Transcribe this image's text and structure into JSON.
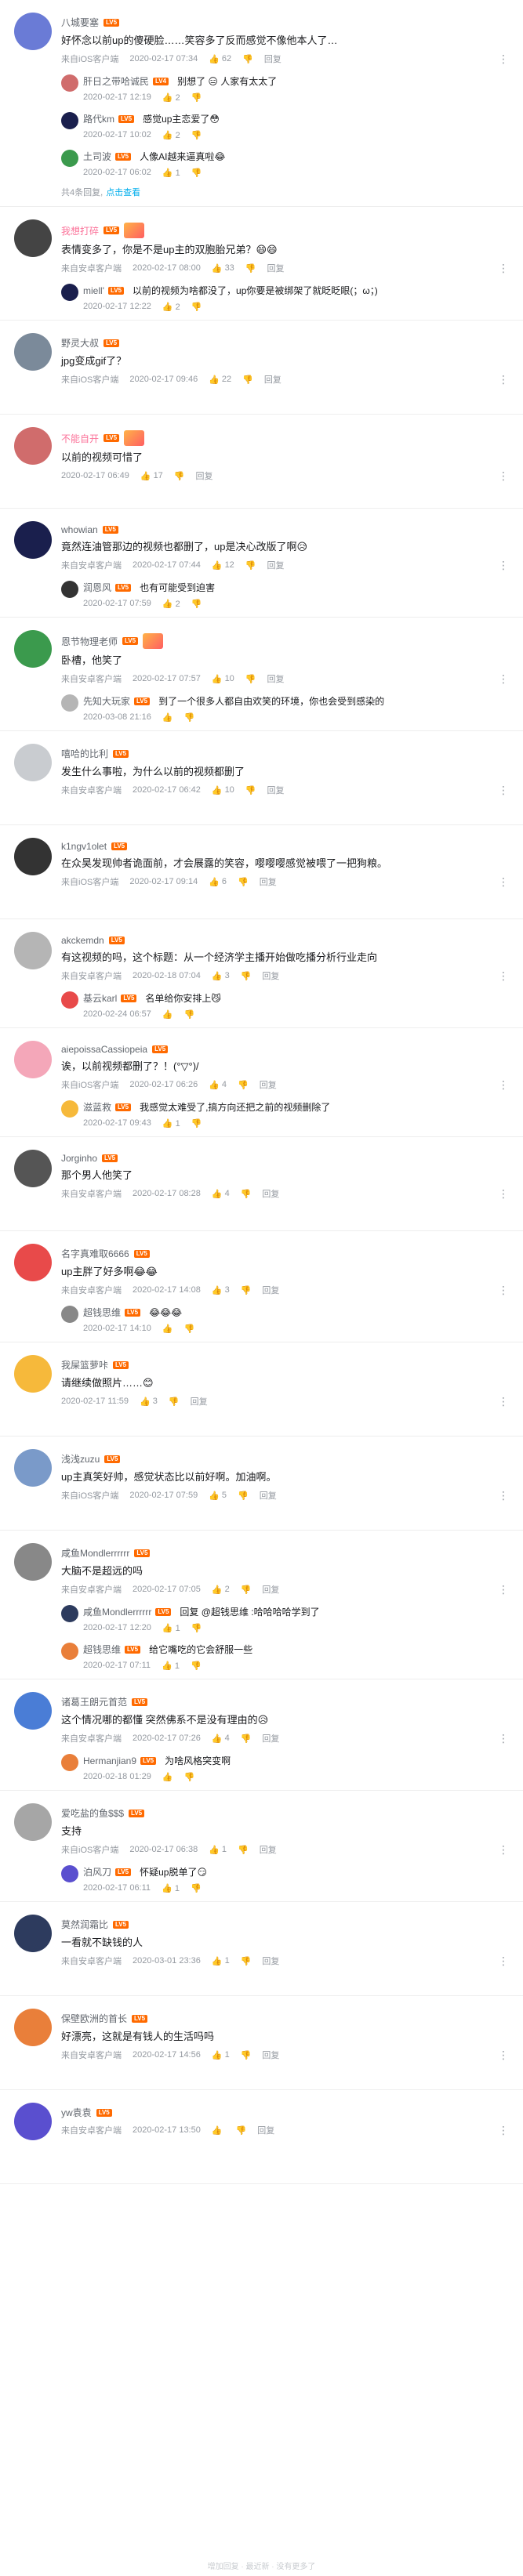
{
  "colors": {
    "accent": "#00aeec",
    "vip_name": "#fb7299",
    "meta": "#9499a0",
    "level_lv6": "#ff3b30",
    "level_lv5": "#ff6a00",
    "level_lv4": "#ff9f1a"
  },
  "comments": [
    {
      "name": "八城要塞",
      "level": "LV5",
      "text": "好怀念以前up的傻硬脸……笑容多了反而感觉不像他本人了…",
      "device": "来自iOS客户端",
      "time": "2020-02-17 07:34",
      "likes": "62",
      "reply": "回复",
      "replies": [
        {
          "name": "肝日之带哈诚民",
          "level": "LV4",
          "text": "别想了 😑 人家有太太了",
          "time": "2020-02-17 12:19",
          "likes": "2"
        },
        {
          "name": "路代km",
          "level": "LV5",
          "text": "感觉up主恋爱了😳",
          "time": "2020-02-17 10:02",
          "likes": "2"
        },
        {
          "name": "土司波",
          "level": "LV5",
          "text": "人像AI越来逼真啦😂",
          "time": "2020-02-17 06:02",
          "likes": "1"
        }
      ],
      "view_more_count": "共4条回复,",
      "view_more_link": "点击查看"
    },
    {
      "name": "我想打碎",
      "level": "LV5",
      "text": "表情变多了，你是不是up主的双胞胎兄弟？😄😄",
      "device": "来自安卓客户端",
      "time": "2020-02-17 08:00",
      "likes": "33",
      "reply": "回复",
      "replies": [
        {
          "name": "miell'",
          "level": "LV5",
          "text": "以前的视频为啥都没了，up你要是被绑架了就眨眨眼(；ω；)",
          "time": "2020-02-17 12:22",
          "likes": "2"
        }
      ]
    },
    {
      "name": "野灵大叔",
      "level": "LV5",
      "text": "jpg变成gif了？",
      "device": "来自iOS客户端",
      "time": "2020-02-17 09:46",
      "likes": "22",
      "reply": "回复",
      "replies": []
    },
    {
      "name": "不能自开",
      "level": "LV5",
      "text": "以前的视频可惜了",
      "device": "",
      "time": "2020-02-17 06:49",
      "likes": "17",
      "reply": "回复",
      "replies": []
    },
    {
      "name": "whowian",
      "level": "LV5",
      "text": "竟然连油管那边的视频也都删了，up是决心改版了啊😥",
      "device": "来自安卓客户端",
      "time": "2020-02-17 07:44",
      "likes": "12",
      "reply": "回复",
      "replies": [
        {
          "name": "润恩风",
          "level": "LV5",
          "text": "也有可能受到迫害",
          "time": "2020-02-17 07:59",
          "likes": "2"
        }
      ]
    },
    {
      "name": "恩节物理老师",
      "level": "LV5",
      "text": "卧槽，他笑了",
      "device": "来自安卓客户端",
      "time": "2020-02-17 07:57",
      "likes": "10",
      "reply": "回复",
      "replies": [
        {
          "name": "先知大玩家",
          "level": "LV5",
          "text": "到了一个很多人都自由欢笑的环境，你也会受到感染的",
          "time": "2020-03-08 21:16",
          "likes": ""
        }
      ]
    },
    {
      "name": "嘻哈的比利",
      "level": "LV5",
      "text": "发生什么事啦，为什么以前的视频都删了",
      "device": "来自安卓客户端",
      "time": "2020-02-17 06:42",
      "likes": "10",
      "reply": "回复",
      "replies": []
    },
    {
      "name": "k1ngv1olet",
      "level": "LV5",
      "text": "在众昊发现帅者诡面前，才会展露的笑容，嘤嘤嘤感觉被喂了一把狗粮。",
      "device": "来自iOS客户端",
      "time": "2020-02-17 09:14",
      "likes": "6",
      "reply": "回复",
      "replies": []
    },
    {
      "name": "akckemdn",
      "level": "LV5",
      "text": "有这视频的吗，这个标题：从一个经济学主播开始做吃播分析行业走向",
      "device": "来自安卓客户端",
      "time": "2020-02-18 07:04",
      "likes": "3",
      "reply": "回复",
      "replies": [
        {
          "name": "基云karl",
          "level": "LV5",
          "text": "名单给你安排上😼",
          "time": "2020-02-24 06:57",
          "likes": ""
        }
      ]
    },
    {
      "name": "aiepoissaCassiopeia",
      "level": "LV5",
      "text": "诶，以前视频都删了？！(°▽°)/",
      "device": "来自iOS客户端",
      "time": "2020-02-17 06:26",
      "likes": "4",
      "reply": "回复",
      "replies": [
        {
          "name": "滋蓝救",
          "level": "LV5",
          "text": "我感觉太难受了,搞方向还把之前的视频删除了",
          "time": "2020-02-17 09:43",
          "likes": "1"
        }
      ]
    },
    {
      "name": "Jorginho",
      "level": "LV5",
      "text": "那个男人他笑了",
      "device": "来自安卓客户端",
      "time": "2020-02-17 08:28",
      "likes": "4",
      "reply": "回复",
      "replies": []
    },
    {
      "name": "名字真难取6666",
      "level": "LV5",
      "text": "up主胖了好多啊😂😂",
      "device": "来自安卓客户端",
      "time": "2020-02-17 14:08",
      "likes": "3",
      "reply": "回复",
      "replies": [
        {
          "name": "超钱思维",
          "level": "LV5",
          "text": "😂😂😂",
          "time": "2020-02-17 14:10",
          "likes": ""
        }
      ]
    },
    {
      "name": "我屎篮萝咔",
      "level": "LV5",
      "text": "请继续做照片……😊",
      "device": "",
      "time": "2020-02-17 11:59",
      "likes": "3",
      "reply": "回复",
      "replies": []
    },
    {
      "name": "浅浅zuzu",
      "level": "LV5",
      "text": "up主真笑好帅，感觉状态比以前好啊。加油啊。",
      "device": "来自iOS客户端",
      "time": "2020-02-17 07:59",
      "likes": "5",
      "reply": "回复",
      "replies": []
    },
    {
      "name": "咸鱼Mondlerrrrrr",
      "level": "LV5",
      "text": "大脑不是超远的吗",
      "device": "来自安卓客户端",
      "time": "2020-02-17 07:05",
      "likes": "2",
      "reply": "回复",
      "replies": [
        {
          "name": "咸鱼Mondlerrrrrr",
          "level": "LV5",
          "text": "回复 @超钱思维 :哈哈哈哈学到了",
          "time": "2020-02-17 12:20",
          "likes": "1"
        },
        {
          "name": "超钱思维",
          "level": "LV5",
          "text": "给它嘴吃的它会舒服一些",
          "time": "2020-02-17 07:11",
          "likes": "1"
        }
      ]
    },
    {
      "name": "诸葛王朗元首范",
      "level": "LV5",
      "text": "这个情况哪的都懂 突然佛系不是没有理由的😥",
      "device": "来自安卓客户端",
      "time": "2020-02-17 07:26",
      "likes": "4",
      "reply": "回复",
      "replies": [
        {
          "name": "Hermanjian9",
          "level": "LV5",
          "text": "为啥风格突变啊",
          "time": "2020-02-18 01:29",
          "likes": ""
        }
      ]
    },
    {
      "name": "爱吃盐的鱼$$$",
      "level": "LV5",
      "text": "支持",
      "device": "来自iOS客户端",
      "time": "2020-02-17 06:38",
      "likes": "1",
      "reply": "回复",
      "replies": [
        {
          "name": "泊风刀",
          "level": "LV5",
          "text": "怀疑up脱单了😏",
          "time": "2020-02-17 06:11",
          "likes": "1"
        }
      ]
    },
    {
      "name": "莫然润霜比",
      "level": "LV5",
      "text": "一看就不缺钱的人",
      "device": "来自安卓客户端",
      "time": "2020-03-01 23:36",
      "likes": "1",
      "reply": "回复",
      "replies": []
    },
    {
      "name": "保壁欧洲的首长",
      "level": "LV5",
      "text": "好漂亮，这就是有钱人的生活吗吗",
      "device": "来自安卓客户端",
      "time": "2020-02-17 14:56",
      "likes": "1",
      "reply": "回复",
      "replies": []
    },
    {
      "name": "yw袁袁",
      "level": "LV5",
      "text": "",
      "device": "来自安卓客户端",
      "time": "2020-02-17 13:50",
      "likes": "",
      "reply": "回复",
      "replies": []
    }
  ],
  "footer": "增加回复 · 最近新 · 没有更多了"
}
